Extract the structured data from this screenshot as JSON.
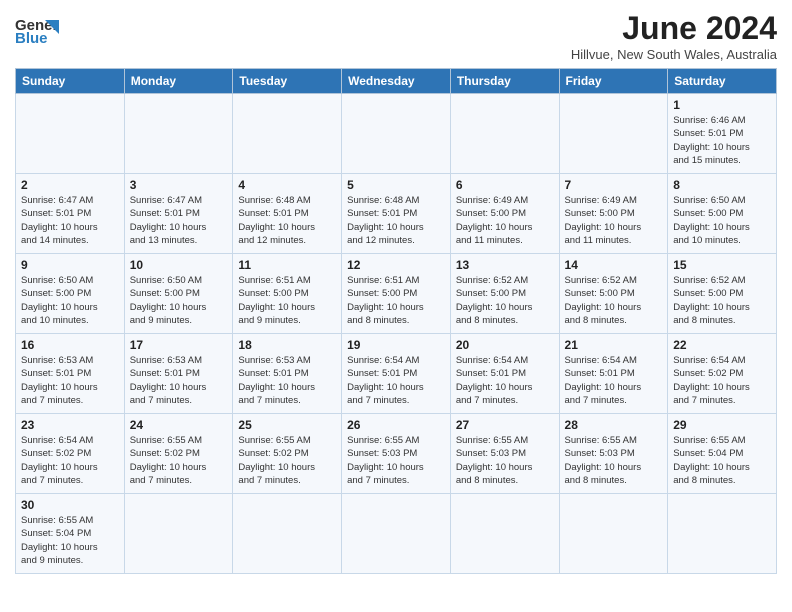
{
  "header": {
    "logo_general": "General",
    "logo_blue": "Blue",
    "title": "June 2024",
    "subtitle": "Hillvue, New South Wales, Australia"
  },
  "calendar": {
    "days_of_week": [
      "Sunday",
      "Monday",
      "Tuesday",
      "Wednesday",
      "Thursday",
      "Friday",
      "Saturday"
    ],
    "weeks": [
      [
        {
          "day": "",
          "info": ""
        },
        {
          "day": "",
          "info": ""
        },
        {
          "day": "",
          "info": ""
        },
        {
          "day": "",
          "info": ""
        },
        {
          "day": "",
          "info": ""
        },
        {
          "day": "",
          "info": ""
        },
        {
          "day": "1",
          "info": "Sunrise: 6:46 AM\nSunset: 5:01 PM\nDaylight: 10 hours\nand 15 minutes."
        }
      ],
      [
        {
          "day": "2",
          "info": "Sunrise: 6:47 AM\nSunset: 5:01 PM\nDaylight: 10 hours\nand 14 minutes."
        },
        {
          "day": "3",
          "info": "Sunrise: 6:47 AM\nSunset: 5:01 PM\nDaylight: 10 hours\nand 13 minutes."
        },
        {
          "day": "4",
          "info": "Sunrise: 6:48 AM\nSunset: 5:01 PM\nDaylight: 10 hours\nand 12 minutes."
        },
        {
          "day": "5",
          "info": "Sunrise: 6:48 AM\nSunset: 5:01 PM\nDaylight: 10 hours\nand 12 minutes."
        },
        {
          "day": "6",
          "info": "Sunrise: 6:49 AM\nSunset: 5:00 PM\nDaylight: 10 hours\nand 11 minutes."
        },
        {
          "day": "7",
          "info": "Sunrise: 6:49 AM\nSunset: 5:00 PM\nDaylight: 10 hours\nand 11 minutes."
        },
        {
          "day": "8",
          "info": "Sunrise: 6:50 AM\nSunset: 5:00 PM\nDaylight: 10 hours\nand 10 minutes."
        }
      ],
      [
        {
          "day": "9",
          "info": "Sunrise: 6:50 AM\nSunset: 5:00 PM\nDaylight: 10 hours\nand 10 minutes."
        },
        {
          "day": "10",
          "info": "Sunrise: 6:50 AM\nSunset: 5:00 PM\nDaylight: 10 hours\nand 9 minutes."
        },
        {
          "day": "11",
          "info": "Sunrise: 6:51 AM\nSunset: 5:00 PM\nDaylight: 10 hours\nand 9 minutes."
        },
        {
          "day": "12",
          "info": "Sunrise: 6:51 AM\nSunset: 5:00 PM\nDaylight: 10 hours\nand 8 minutes."
        },
        {
          "day": "13",
          "info": "Sunrise: 6:52 AM\nSunset: 5:00 PM\nDaylight: 10 hours\nand 8 minutes."
        },
        {
          "day": "14",
          "info": "Sunrise: 6:52 AM\nSunset: 5:00 PM\nDaylight: 10 hours\nand 8 minutes."
        },
        {
          "day": "15",
          "info": "Sunrise: 6:52 AM\nSunset: 5:00 PM\nDaylight: 10 hours\nand 8 minutes."
        }
      ],
      [
        {
          "day": "16",
          "info": "Sunrise: 6:53 AM\nSunset: 5:01 PM\nDaylight: 10 hours\nand 7 minutes."
        },
        {
          "day": "17",
          "info": "Sunrise: 6:53 AM\nSunset: 5:01 PM\nDaylight: 10 hours\nand 7 minutes."
        },
        {
          "day": "18",
          "info": "Sunrise: 6:53 AM\nSunset: 5:01 PM\nDaylight: 10 hours\nand 7 minutes."
        },
        {
          "day": "19",
          "info": "Sunrise: 6:54 AM\nSunset: 5:01 PM\nDaylight: 10 hours\nand 7 minutes."
        },
        {
          "day": "20",
          "info": "Sunrise: 6:54 AM\nSunset: 5:01 PM\nDaylight: 10 hours\nand 7 minutes."
        },
        {
          "day": "21",
          "info": "Sunrise: 6:54 AM\nSunset: 5:01 PM\nDaylight: 10 hours\nand 7 minutes."
        },
        {
          "day": "22",
          "info": "Sunrise: 6:54 AM\nSunset: 5:02 PM\nDaylight: 10 hours\nand 7 minutes."
        }
      ],
      [
        {
          "day": "23",
          "info": "Sunrise: 6:54 AM\nSunset: 5:02 PM\nDaylight: 10 hours\nand 7 minutes."
        },
        {
          "day": "24",
          "info": "Sunrise: 6:55 AM\nSunset: 5:02 PM\nDaylight: 10 hours\nand 7 minutes."
        },
        {
          "day": "25",
          "info": "Sunrise: 6:55 AM\nSunset: 5:02 PM\nDaylight: 10 hours\nand 7 minutes."
        },
        {
          "day": "26",
          "info": "Sunrise: 6:55 AM\nSunset: 5:03 PM\nDaylight: 10 hours\nand 7 minutes."
        },
        {
          "day": "27",
          "info": "Sunrise: 6:55 AM\nSunset: 5:03 PM\nDaylight: 10 hours\nand 8 minutes."
        },
        {
          "day": "28",
          "info": "Sunrise: 6:55 AM\nSunset: 5:03 PM\nDaylight: 10 hours\nand 8 minutes."
        },
        {
          "day": "29",
          "info": "Sunrise: 6:55 AM\nSunset: 5:04 PM\nDaylight: 10 hours\nand 8 minutes."
        }
      ],
      [
        {
          "day": "30",
          "info": "Sunrise: 6:55 AM\nSunset: 5:04 PM\nDaylight: 10 hours\nand 9 minutes."
        },
        {
          "day": "",
          "info": ""
        },
        {
          "day": "",
          "info": ""
        },
        {
          "day": "",
          "info": ""
        },
        {
          "day": "",
          "info": ""
        },
        {
          "day": "",
          "info": ""
        },
        {
          "day": "",
          "info": ""
        }
      ]
    ]
  }
}
